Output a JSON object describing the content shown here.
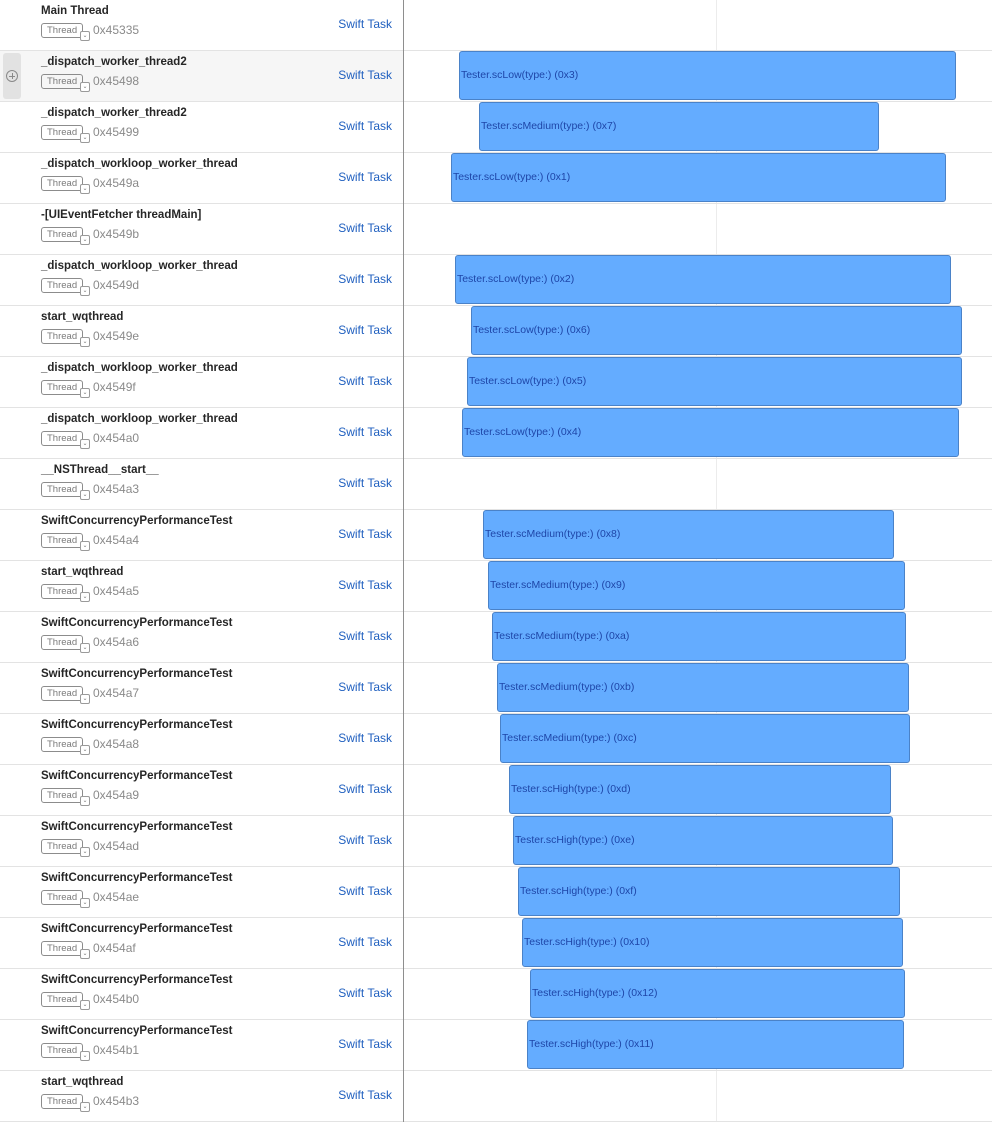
{
  "link_label": "Swift Task",
  "badge_label": "Thread",
  "timeline": {
    "gridline_fraction": 0.5306,
    "bar_color": "#64acff",
    "link_color": "#1f5fbf"
  },
  "rows": [
    {
      "name": "Main Thread",
      "id": "0x45335",
      "task": null
    },
    {
      "name": "_dispatch_worker_thread2",
      "id": "0x45498",
      "hover": true,
      "task": {
        "label": "Tester.scLow(type:) (0x3)",
        "start": 0.0935,
        "end": 0.939
      }
    },
    {
      "name": "_dispatch_worker_thread2",
      "id": "0x45499",
      "task": {
        "label": "Tester.scMedium(type:) (0x7)",
        "start": 0.1276,
        "end": 0.8078
      }
    },
    {
      "name": "_dispatch_workloop_worker_thread",
      "id": "0x4549a",
      "task": {
        "label": "Tester.scLow(type:) (0x1)",
        "start": 0.0799,
        "end": 0.9218
      }
    },
    {
      "name": "-[UIEventFetcher threadMain]",
      "id": "0x4549b",
      "task": null
    },
    {
      "name": "_dispatch_workloop_worker_thread",
      "id": "0x4549d",
      "task": {
        "label": "Tester.scLow(type:) (0x2)",
        "start": 0.0867,
        "end": 0.9303
      }
    },
    {
      "name": "start_wqthread",
      "id": "0x4549e",
      "task": {
        "label": "Tester.scLow(type:) (0x6)",
        "start": 0.1139,
        "end": 0.949
      }
    },
    {
      "name": "_dispatch_workloop_worker_thread",
      "id": "0x4549f",
      "task": {
        "label": "Tester.scLow(type:) (0x5)",
        "start": 0.1071,
        "end": 0.949
      }
    },
    {
      "name": "_dispatch_workloop_worker_thread",
      "id": "0x454a0",
      "task": {
        "label": "Tester.scLow(type:) (0x4)",
        "start": 0.0986,
        "end": 0.9439
      }
    },
    {
      "name": "__NSThread__start__",
      "id": "0x454a3",
      "task": null
    },
    {
      "name": "SwiftConcurrencyPerformanceTest",
      "id": "0x454a4",
      "task": {
        "label": "Tester.scMedium(type:) (0x8)",
        "start": 0.1344,
        "end": 0.8333
      }
    },
    {
      "name": "start_wqthread",
      "id": "0x454a5",
      "task": {
        "label": "Tester.scMedium(type:) (0x9)",
        "start": 0.1429,
        "end": 0.852
      }
    },
    {
      "name": "SwiftConcurrencyPerformanceTest",
      "id": "0x454a6",
      "task": {
        "label": "Tester.scMedium(type:) (0xa)",
        "start": 0.1497,
        "end": 0.8537
      }
    },
    {
      "name": "SwiftConcurrencyPerformanceTest",
      "id": "0x454a7",
      "task": {
        "label": "Tester.scMedium(type:) (0xb)",
        "start": 0.1582,
        "end": 0.8588
      }
    },
    {
      "name": "SwiftConcurrencyPerformanceTest",
      "id": "0x454a8",
      "task": {
        "label": "Tester.scMedium(type:) (0xc)",
        "start": 0.1633,
        "end": 0.8605
      }
    },
    {
      "name": "SwiftConcurrencyPerformanceTest",
      "id": "0x454a9",
      "task": {
        "label": "Tester.scHigh(type:) (0xd)",
        "start": 0.1786,
        "end": 0.8282
      }
    },
    {
      "name": "SwiftConcurrencyPerformanceTest",
      "id": "0x454ad",
      "task": {
        "label": "Tester.scHigh(type:) (0xe)",
        "start": 0.1854,
        "end": 0.8316
      }
    },
    {
      "name": "SwiftConcurrencyPerformanceTest",
      "id": "0x454ae",
      "task": {
        "label": "Tester.scHigh(type:) (0xf)",
        "start": 0.1939,
        "end": 0.8435
      }
    },
    {
      "name": "SwiftConcurrencyPerformanceTest",
      "id": "0x454af",
      "task": {
        "label": "Tester.scHigh(type:) (0x10)",
        "start": 0.2007,
        "end": 0.8486
      }
    },
    {
      "name": "SwiftConcurrencyPerformanceTest",
      "id": "0x454b0",
      "task": {
        "label": "Tester.scHigh(type:) (0x12)",
        "start": 0.2143,
        "end": 0.852
      }
    },
    {
      "name": "SwiftConcurrencyPerformanceTest",
      "id": "0x454b1",
      "task": {
        "label": "Tester.scHigh(type:) (0x11)",
        "start": 0.2092,
        "end": 0.8503
      }
    },
    {
      "name": "start_wqthread",
      "id": "0x454b3",
      "task": null
    }
  ]
}
